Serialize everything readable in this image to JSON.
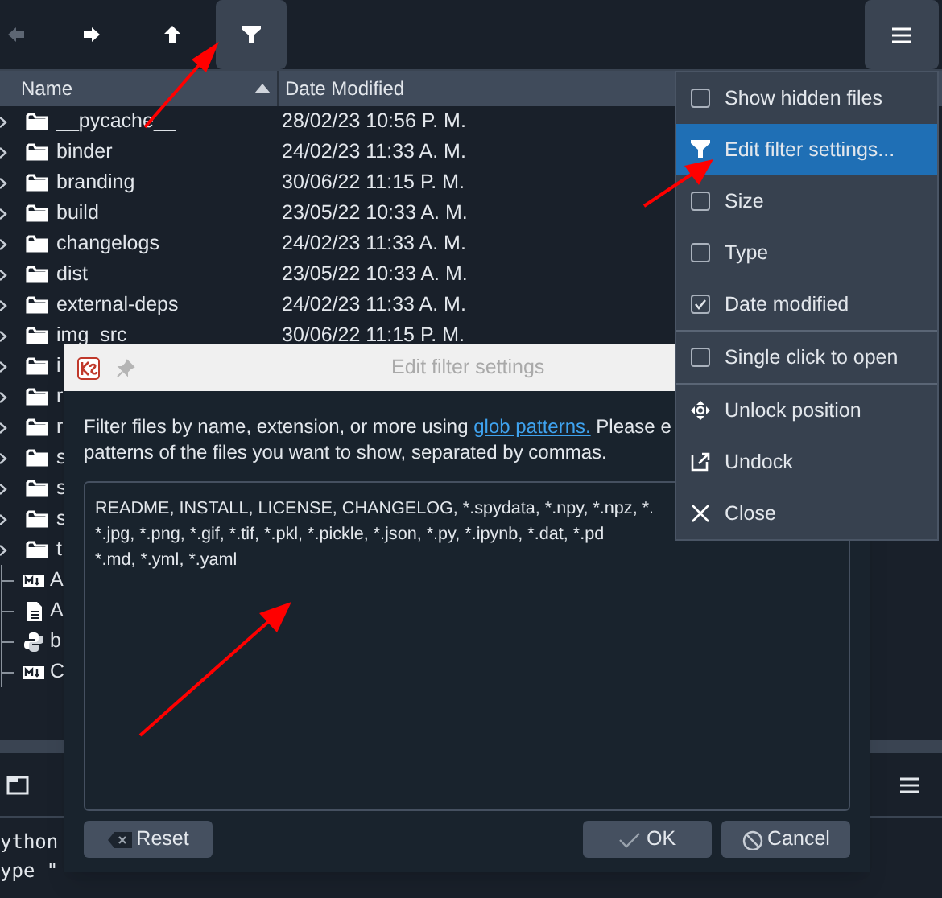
{
  "toolbar": {
    "buttons": [
      {
        "kind": "back",
        "disabled": true,
        "pressed": false
      },
      {
        "kind": "forward",
        "disabled": false,
        "pressed": false
      },
      {
        "kind": "up",
        "disabled": false,
        "pressed": false
      },
      {
        "kind": "filter",
        "disabled": false,
        "pressed": true
      }
    ],
    "menu_button": {
      "pressed": true
    }
  },
  "file_list": {
    "columns": [
      {
        "label": "Name",
        "sorted": true
      },
      {
        "label": "Date Modified"
      }
    ],
    "rows": [
      {
        "kind": "folder",
        "name": "__pycache__",
        "date": "28/02/23 10:56 P. M."
      },
      {
        "kind": "folder",
        "name": "binder",
        "date": "24/02/23 11:33 A. M."
      },
      {
        "kind": "folder",
        "name": "branding",
        "date": "30/06/22 11:15 P. M."
      },
      {
        "kind": "folder",
        "name": "build",
        "date": "23/05/22 10:33 A. M."
      },
      {
        "kind": "folder",
        "name": "changelogs",
        "date": "24/02/23 11:33 A. M."
      },
      {
        "kind": "folder",
        "name": "dist",
        "date": "23/05/22 10:33 A. M."
      },
      {
        "kind": "folder",
        "name": "external-deps",
        "date": "24/02/23 11:33 A. M."
      },
      {
        "kind": "folder",
        "name": "img_src",
        "date": "30/06/22 11:15 P. M."
      },
      {
        "kind": "folder",
        "name": "i"
      },
      {
        "kind": "folder",
        "name": "r"
      },
      {
        "kind": "folder",
        "name": "r"
      },
      {
        "kind": "folder",
        "name": "s"
      },
      {
        "kind": "folder",
        "name": "s"
      },
      {
        "kind": "folder",
        "name": "s"
      },
      {
        "kind": "folder",
        "name": "t"
      },
      {
        "kind": "markdown",
        "name": "A"
      },
      {
        "kind": "text",
        "name": "A"
      },
      {
        "kind": "python",
        "name": "b"
      },
      {
        "kind": "markdown",
        "name": "C"
      }
    ]
  },
  "console": {
    "lines": [
      "ython",
      "ype \""
    ]
  },
  "dialog": {
    "title": "Edit filter settings",
    "description": {
      "before": "Filter files by name, extension, or more using ",
      "link": "glob patterns.",
      "after": " Please e",
      "line_2": "patterns of the files you want to show, separated by commas."
    },
    "filter_text": "README, INSTALL, LICENSE, CHANGELOG, *.spydata, *.npy, *.npz, *.\n*.jpg, *.png, *.gif, *.tif, *.pkl, *.pickle, *.json, *.py, *.ipynb, *.dat, *.pd\n*.md, *.yml, *.yaml",
    "buttons": [
      {
        "kind": "reset",
        "label": "Reset"
      },
      {
        "kind": "ok",
        "label": "OK"
      },
      {
        "kind": "cancel",
        "label": "Cancel"
      }
    ]
  },
  "menu": {
    "items": [
      {
        "kind": "checkbox",
        "label": "Show hidden files",
        "checked": false,
        "selected": false
      },
      {
        "kind": "filter",
        "label": "Edit filter settings...",
        "selected": true
      },
      {
        "kind": "checkbox",
        "label": "Size",
        "checked": false,
        "selected": false
      },
      {
        "kind": "checkbox",
        "label": "Type",
        "checked": false,
        "selected": false
      },
      {
        "kind": "checkbox",
        "label": "Date modified",
        "checked": true,
        "selected": false
      },
      {
        "kind": "separator"
      },
      {
        "kind": "checkbox",
        "label": "Single click to open",
        "checked": false,
        "selected": false
      },
      {
        "kind": "separator"
      },
      {
        "kind": "unlock",
        "label": "Unlock position",
        "selected": false
      },
      {
        "kind": "undock",
        "label": "Undock",
        "selected": false
      },
      {
        "kind": "close",
        "label": "Close",
        "selected": false
      }
    ]
  }
}
